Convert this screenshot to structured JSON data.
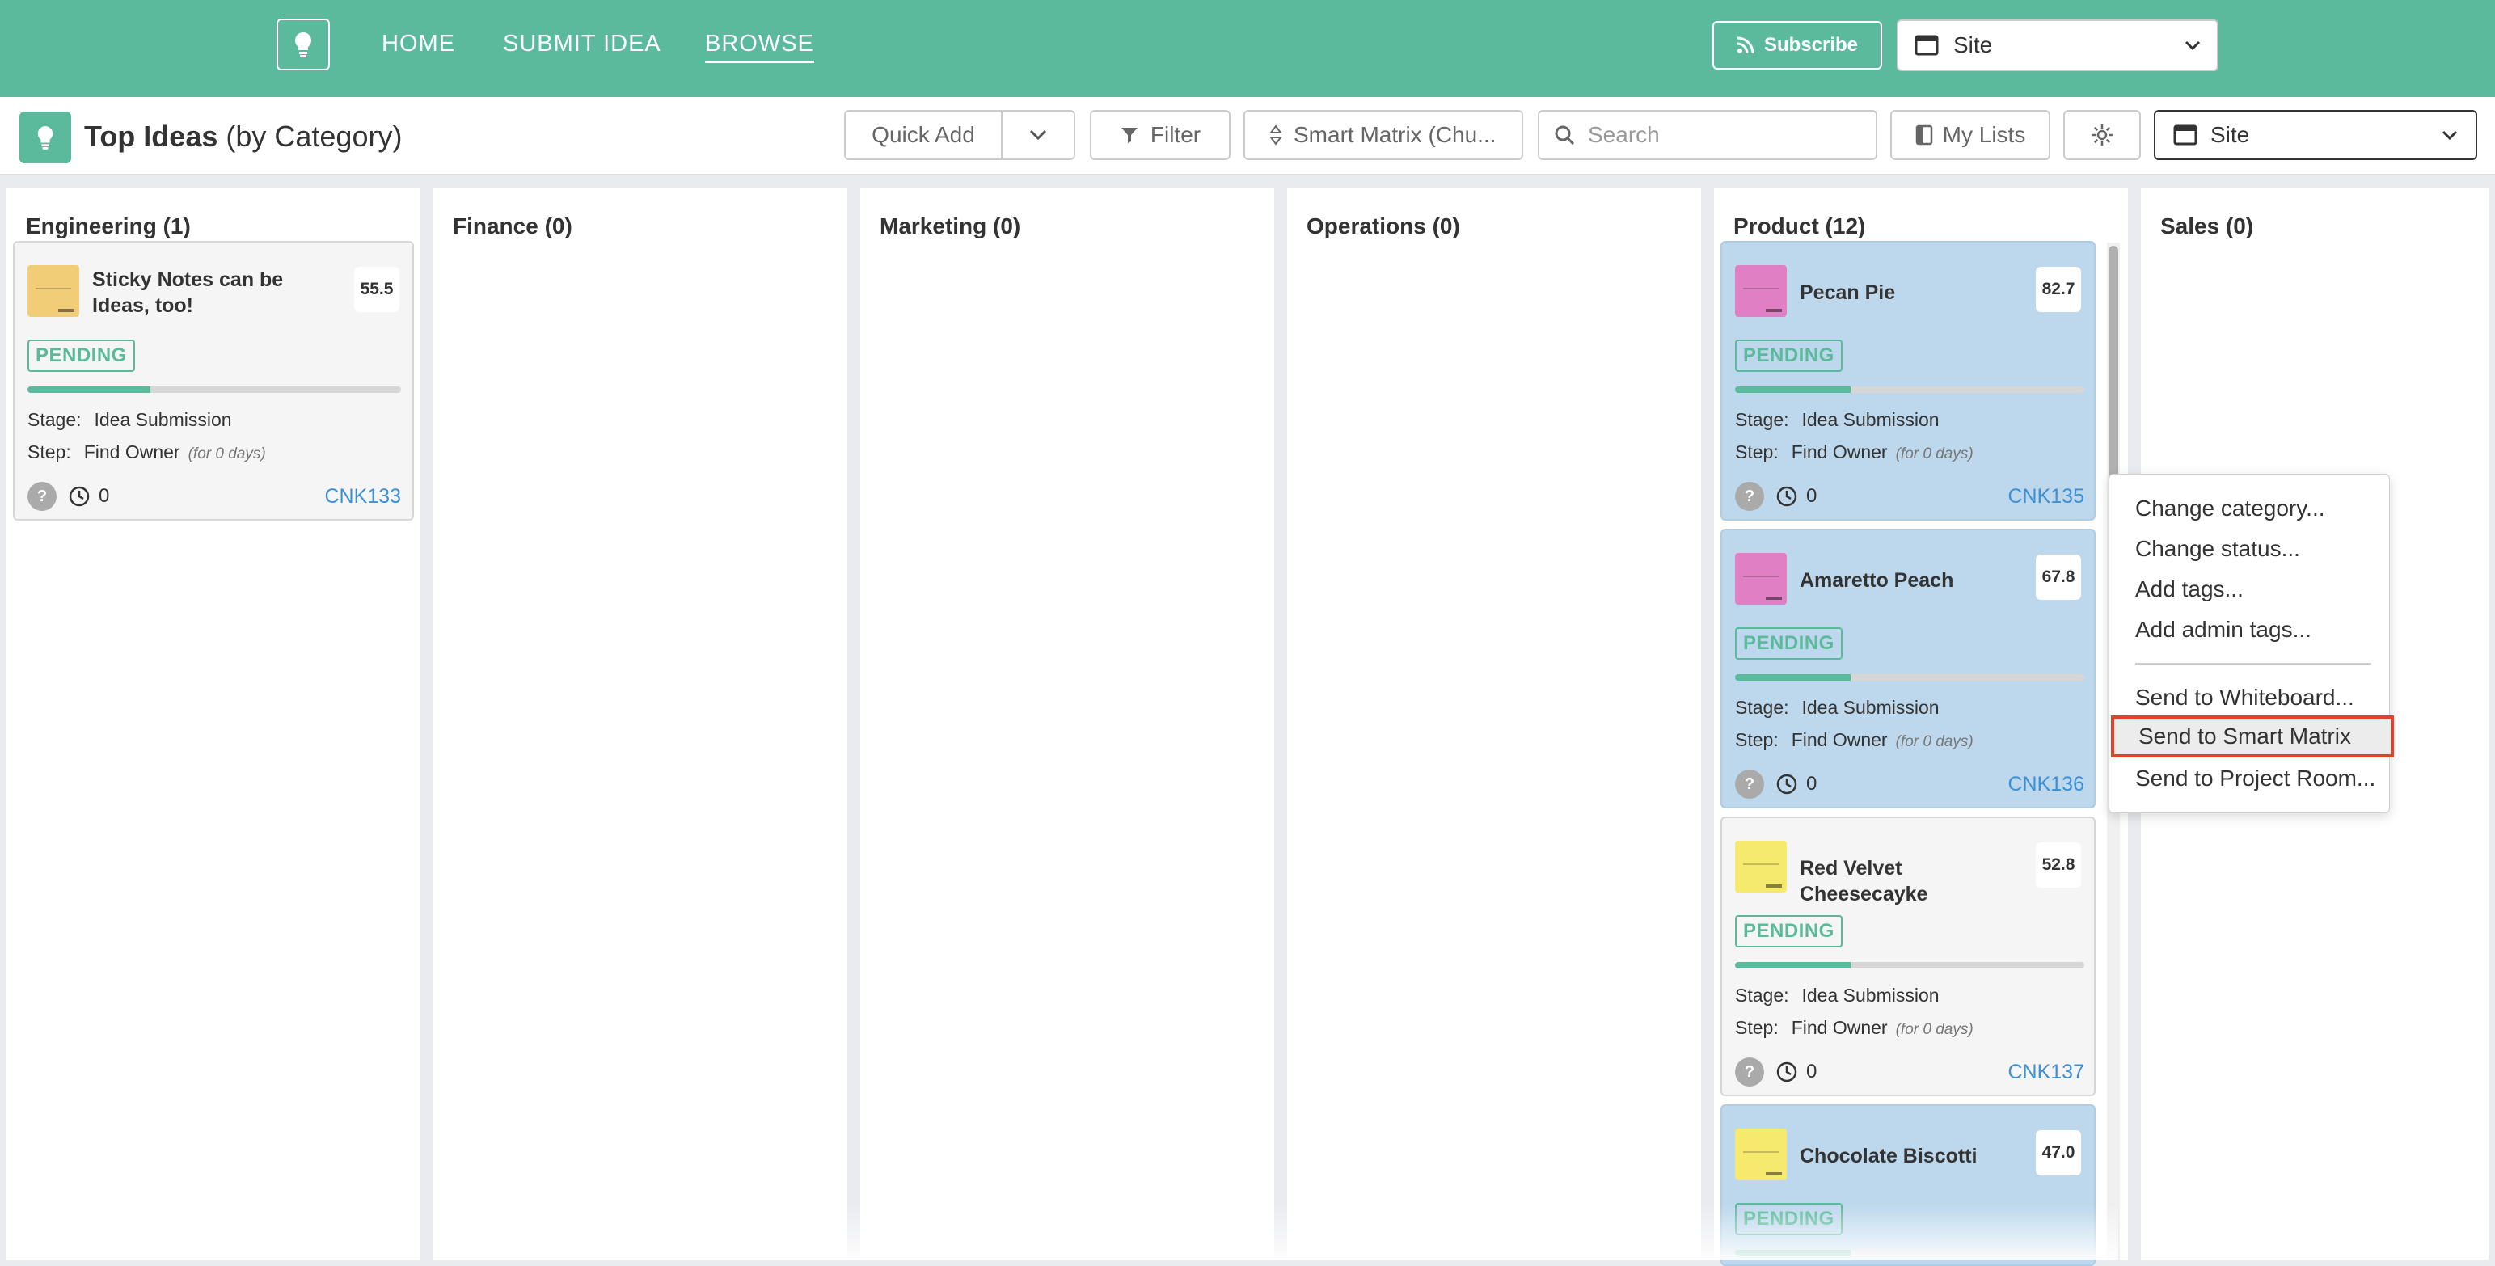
{
  "nav": {
    "links": [
      "HOME",
      "SUBMIT IDEA",
      "BROWSE"
    ],
    "active": "BROWSE",
    "subscribe_label": "Subscribe",
    "site_selector": "Site"
  },
  "toolbar": {
    "title_bold": "Top Ideas",
    "title_suffix": "(by Category)",
    "quick_add_label": "Quick Add",
    "filter_label": "Filter",
    "smart_matrix_label": "Smart Matrix (Chu...",
    "search_placeholder": "Search",
    "my_lists_label": "My Lists",
    "site_selector": "Site"
  },
  "columns": [
    {
      "title": "Engineering (1)"
    },
    {
      "title": "Finance (0)"
    },
    {
      "title": "Marketing (0)"
    },
    {
      "title": "Operations (0)"
    },
    {
      "title": "Product (12)"
    },
    {
      "title": "Sales (0)"
    }
  ],
  "cards": [
    {
      "title": "Sticky Notes can be Ideas, too!",
      "score": "55.5",
      "status": "PENDING",
      "progress": 0.33,
      "stage_label": "Stage:",
      "stage": "Idea Submission",
      "step_label": "Step:",
      "step": "Find Owner",
      "duration": "(for 0 days)",
      "avatar": "?",
      "count": "0",
      "id": "CNK133",
      "thumb_color": "#f0cd76"
    },
    {
      "title": "Pecan Pie",
      "score": "82.7",
      "status": "PENDING",
      "progress": 0.33,
      "stage_label": "Stage:",
      "stage": "Idea Submission",
      "step_label": "Step:",
      "step": "Find Owner",
      "duration": "(for 0 days)",
      "avatar": "?",
      "count": "0",
      "id": "CNK135",
      "thumb_color": "#e07fc4"
    },
    {
      "title": "Amaretto Peach",
      "score": "67.8",
      "status": "PENDING",
      "progress": 0.33,
      "stage_label": "Stage:",
      "stage": "Idea Submission",
      "step_label": "Step:",
      "step": "Find Owner",
      "duration": "(for 0 days)",
      "avatar": "?",
      "count": "0",
      "id": "CNK136",
      "thumb_color": "#e07fc4"
    },
    {
      "title": "Red Velvet Cheesecayke",
      "score": "52.8",
      "status": "PENDING",
      "progress": 0.33,
      "stage_label": "Stage:",
      "stage": "Idea Submission",
      "step_label": "Step:",
      "step": "Find Owner",
      "duration": "(for 0 days)",
      "avatar": "?",
      "count": "0",
      "id": "CNK137",
      "thumb_color": "#f5ea6e"
    },
    {
      "title": "Chocolate Biscotti",
      "score": "47.0",
      "status": "PENDING",
      "progress": 0.33,
      "thumb_color": "#f5ea6e"
    }
  ],
  "context_menu": {
    "items": [
      "Change category...",
      "Change status...",
      "Add tags...",
      "Add admin tags...",
      "Send to Whiteboard...",
      "Send to Smart Matrix",
      "Send to Project Room..."
    ],
    "highlighted": "Send to Smart Matrix"
  },
  "colors": {
    "brand": "#5bba9b",
    "card_selected": "#bdd8ec",
    "link": "#3d8fd6",
    "highlight_border": "#e2412c"
  }
}
